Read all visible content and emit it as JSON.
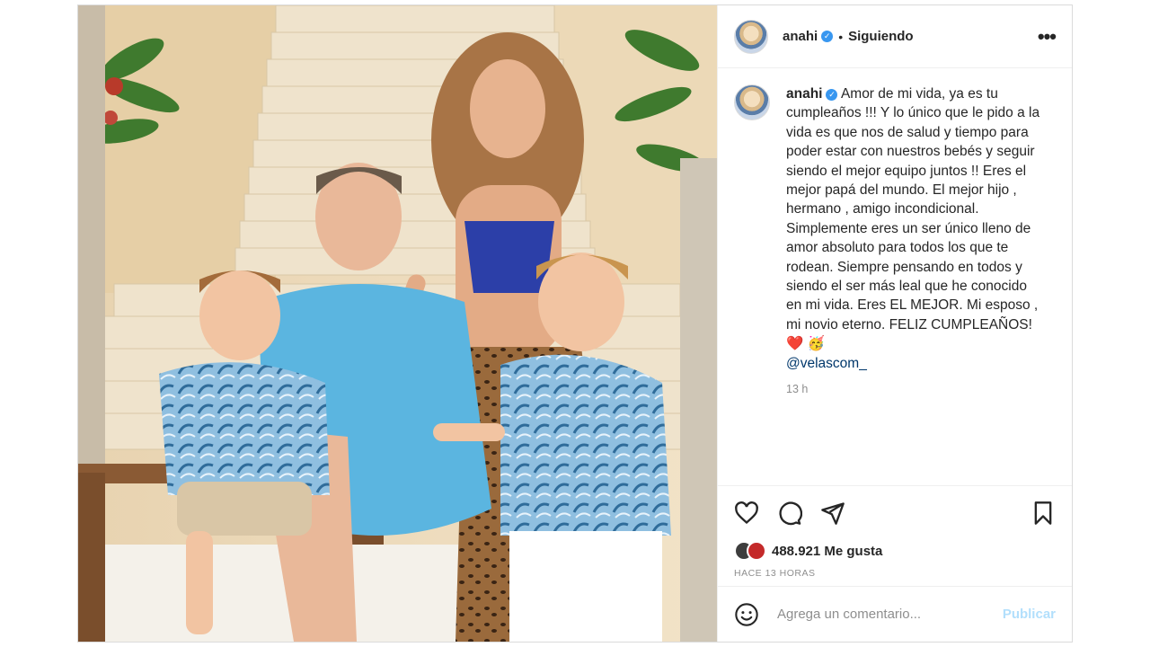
{
  "post": {
    "username": "anahi",
    "verified_icon": "verified-badge-icon",
    "follow_status": "Siguiendo",
    "more_icon": "more-options-icon"
  },
  "caption": {
    "username": "anahi",
    "text": "Amor de mi vida, ya es tu cumpleaños !!! Y lo único que le pido a la vida es que nos de salud y tiempo para poder estar con nuestros bebés y seguir siendo el mejor equipo juntos !! Eres el mejor papá del mundo. El mejor hijo , hermano , amigo incondicional. Simplemente eres un ser único lleno de amor absoluto para todos los que te rodean. Siempre pensando en todos y siendo el ser más leal que he conocido en mi vida. Eres EL MEJOR. Mi esposo , mi novio eterno. FELIZ CUMPLEAÑOS!",
    "emojis": "❤️ 🥳",
    "mention": "@velascom_",
    "time": "13 h"
  },
  "likes": {
    "text": "488.921 Me gusta"
  },
  "posted_ago": "HACE 13 HORAS",
  "comment_box": {
    "placeholder": "Agrega un comentario...",
    "publish": "Publicar"
  },
  "colors": {
    "link": "#00376b",
    "verified": "#3897f0",
    "publish_disabled": "#b2dffc"
  }
}
